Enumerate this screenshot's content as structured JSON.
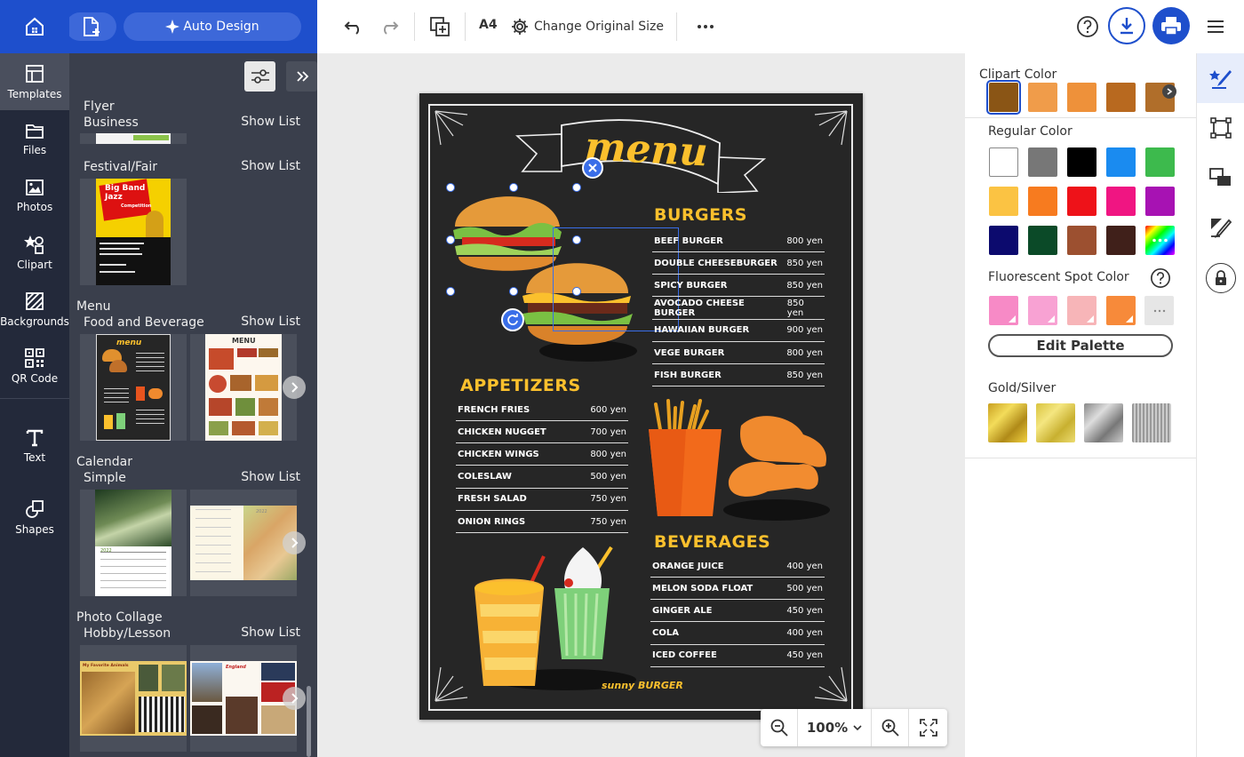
{
  "toolbar": {
    "auto_design_label": "Auto Design",
    "paper_size": "A4",
    "change_size_label": "Change Original Size"
  },
  "rail": [
    {
      "label": "Templates",
      "icon": "templates-icon"
    },
    {
      "label": "Files",
      "icon": "folder-icon"
    },
    {
      "label": "Photos",
      "icon": "photo-icon"
    },
    {
      "label": "Clipart",
      "icon": "clipart-icon"
    },
    {
      "label": "Backgrounds",
      "icon": "backgrounds-icon"
    },
    {
      "label": "QR Code",
      "icon": "qr-code-icon"
    },
    {
      "label": "Text",
      "icon": "text-icon"
    },
    {
      "label": "Shapes",
      "icon": "shapes-icon"
    }
  ],
  "panel": {
    "show_list": "Show List",
    "sections": [
      {
        "category": "Flyer",
        "sub": "Business"
      },
      {
        "category": "",
        "sub": "Festival/Fair"
      },
      {
        "category": "Menu",
        "sub": "Food and Beverage"
      },
      {
        "category": "Calendar",
        "sub": "Simple"
      },
      {
        "category": "Photo Collage",
        "sub": "Hobby/Lesson"
      }
    ],
    "thumb_texts": {
      "festival": [
        "Big Band",
        "Jazz",
        "Competition"
      ],
      "menu_dark": "menu",
      "menu_light": "MENU",
      "collage1": "My Favorite Animals",
      "collage2": "England",
      "calendar_year": "2022"
    }
  },
  "menu": {
    "title": "menu",
    "footer": "sunny BURGER",
    "burgers": {
      "heading": "BURGERS",
      "items": [
        {
          "name": "BEEF BURGER",
          "price": "800 yen"
        },
        {
          "name": "DOUBLE CHEESEBURGER",
          "price": "850 yen"
        },
        {
          "name": "SPICY BURGER",
          "price": "850 yen"
        },
        {
          "name": "AVOCADO CHEESE BURGER",
          "price": "850 yen"
        },
        {
          "name": "HAWAIIAN BURGER",
          "price": "900 yen"
        },
        {
          "name": "VEGE BURGER",
          "price": "800 yen"
        },
        {
          "name": "FISH BURGER",
          "price": "850 yen"
        }
      ]
    },
    "appetizers": {
      "heading": "APPETIZERS",
      "items": [
        {
          "name": "FRENCH FRIES",
          "price": "600 yen"
        },
        {
          "name": "CHICKEN NUGGET",
          "price": "700 yen"
        },
        {
          "name": "CHICKEN WINGS",
          "price": "800 yen"
        },
        {
          "name": "COLESLAW",
          "price": "500 yen"
        },
        {
          "name": "FRESH SALAD",
          "price": "750 yen"
        },
        {
          "name": "ONION RINGS",
          "price": "750 yen"
        }
      ]
    },
    "beverages": {
      "heading": "BEVERAGES",
      "items": [
        {
          "name": "ORANGE JUICE",
          "price": "400 yen"
        },
        {
          "name": "MELON SODA FLOAT",
          "price": "500 yen"
        },
        {
          "name": "GINGER ALE",
          "price": "450 yen"
        },
        {
          "name": "COLA",
          "price": "400 yen"
        },
        {
          "name": "ICED COFFEE",
          "price": "450 yen"
        }
      ]
    }
  },
  "zoom": {
    "level": "100%"
  },
  "colors": {
    "clipart_label": "Clipart Color",
    "clipart": [
      "#8a5515",
      "#f09c4a",
      "#ee913a",
      "#b8691f",
      "#b06e2a"
    ],
    "regular_label": "Regular Color",
    "regular": [
      "#ffffff",
      "#777777",
      "#000000",
      "#1a8bf0",
      "#3dba4d",
      "#fbc343",
      "#f77b1f",
      "#ee1219",
      "#f01582",
      "#a712b3",
      "#0c0a6e",
      "#0b4a28",
      "#9c5030",
      "#40201a",
      "#rainbow"
    ],
    "fluorescent_label": "Fluorescent Spot Color",
    "fluorescent": [
      "#f78ac6",
      "#f8a2d3",
      "#f7b5b8",
      "#f78a3a"
    ],
    "edit_palette": "Edit Palette",
    "gold_label": "Gold/Silver"
  }
}
